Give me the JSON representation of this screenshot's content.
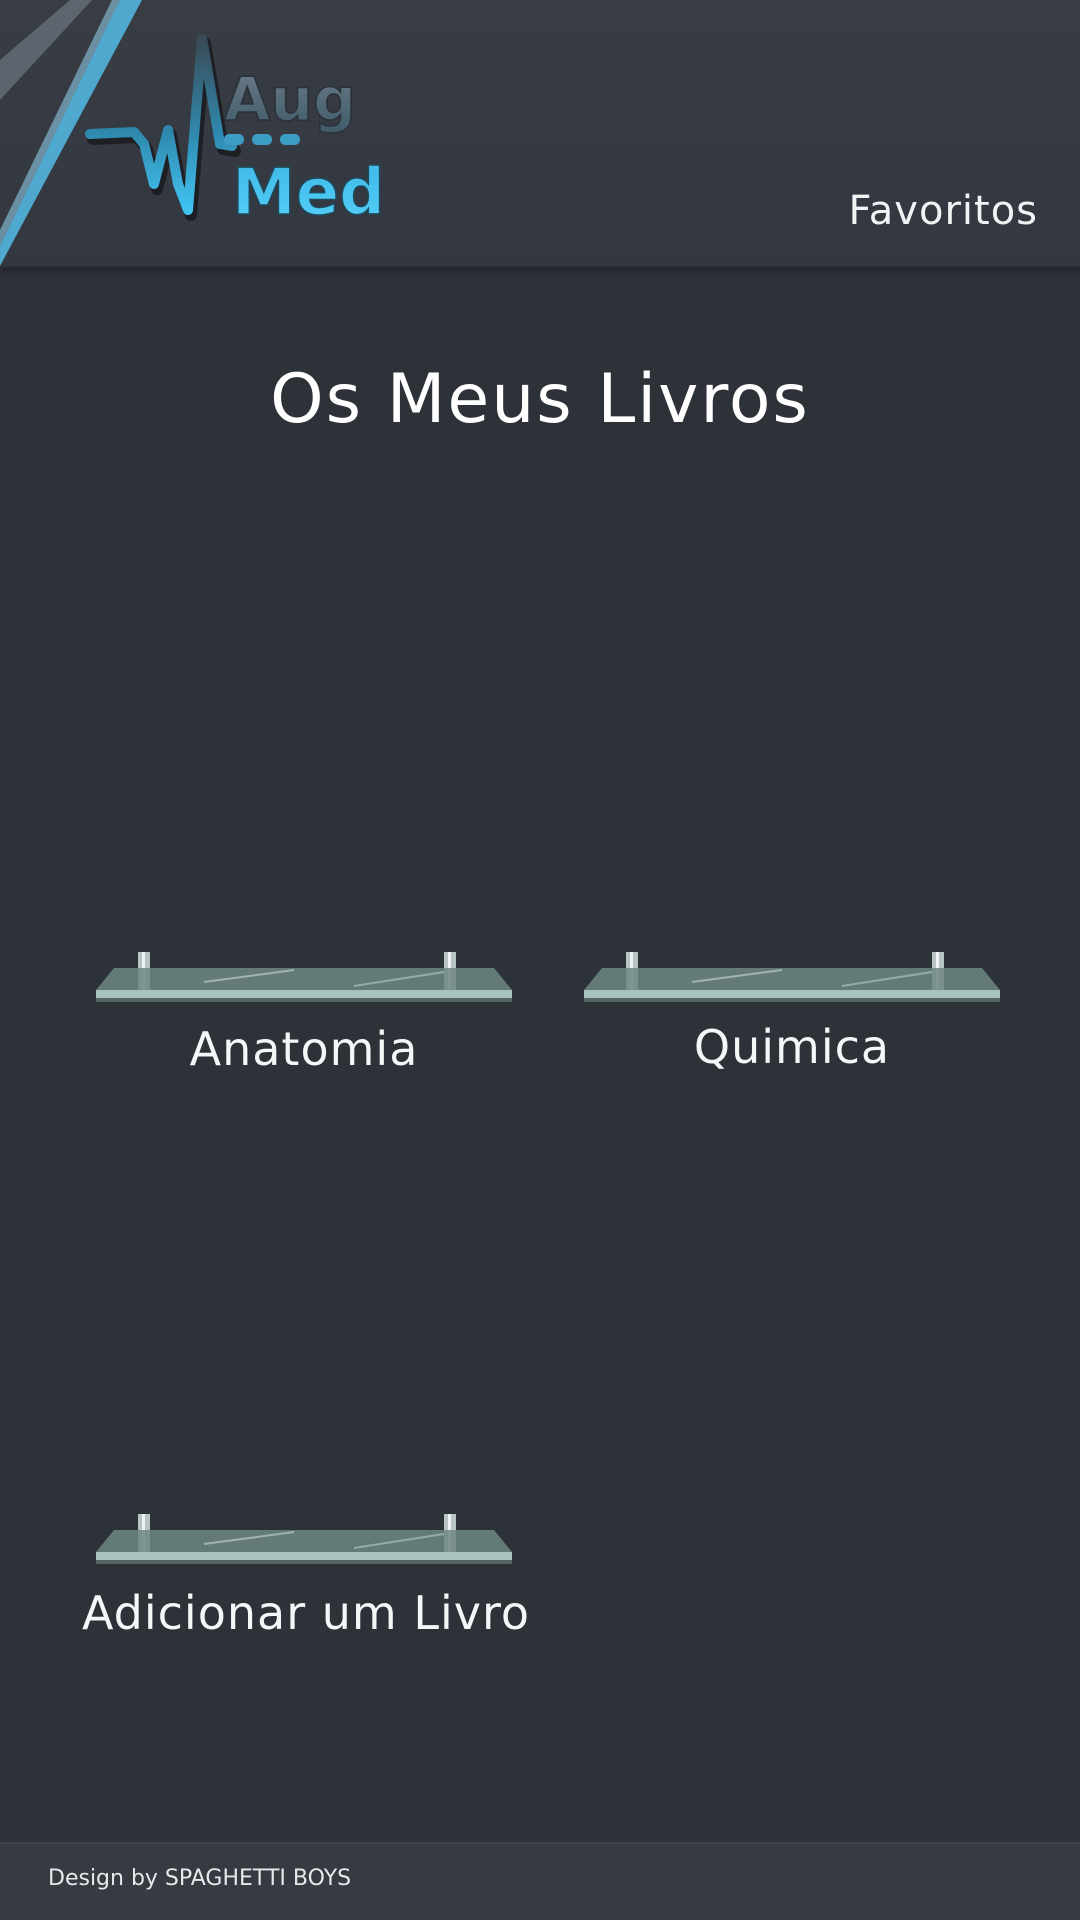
{
  "header": {
    "logo": {
      "line1": "Aug",
      "line2": "Med",
      "icon": "heartbeat-pulse-icon"
    },
    "favorites_label": "Favoritos"
  },
  "main": {
    "title": "Os Meus Livros",
    "shelves": [
      {
        "label": "Anatomia",
        "icon": "glass-shelf-icon"
      },
      {
        "label": "Quimica",
        "icon": "glass-shelf-icon"
      },
      {
        "label": "Adicionar um Livro",
        "icon": "glass-shelf-icon"
      }
    ]
  },
  "footer": {
    "credit": "Design by SPAGHETTI BOYS"
  },
  "colors": {
    "background": "#2d3138",
    "header": "#363a41",
    "accent": "#3fb8e6",
    "text": "#f4f6f8",
    "glass": "#a9c2bf"
  }
}
